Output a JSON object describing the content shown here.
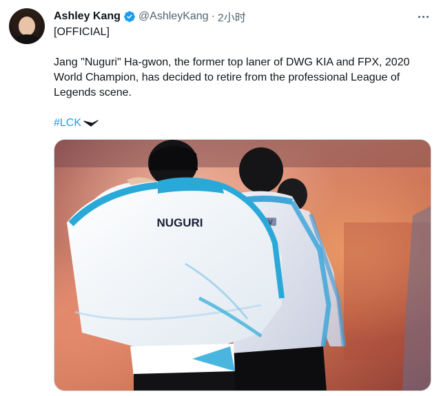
{
  "author": {
    "display_name": "Ashley Kang",
    "handle": "@AshleyKang",
    "separator": "·",
    "time": "2小时",
    "verified": true
  },
  "tweet": {
    "tag_line": "[OFFICIAL]",
    "text": "Jang \"Nuguri\" Ha-gwon, the former top laner of DWG KIA and FPX, 2020 World Champion, has decided to retire from the professional League of Legends scene.",
    "hashtag": "#LCK",
    "hashtag_emoji": "arrow-icon"
  },
  "media": {
    "jacket_text": "NUGURI",
    "second_jacket_text": "NOV"
  },
  "colors": {
    "accent": "#1d9bf0",
    "text_primary": "#0f1419",
    "text_secondary": "#536471"
  },
  "icons": {
    "more": "more-icon",
    "verified": "verified-badge-icon"
  }
}
